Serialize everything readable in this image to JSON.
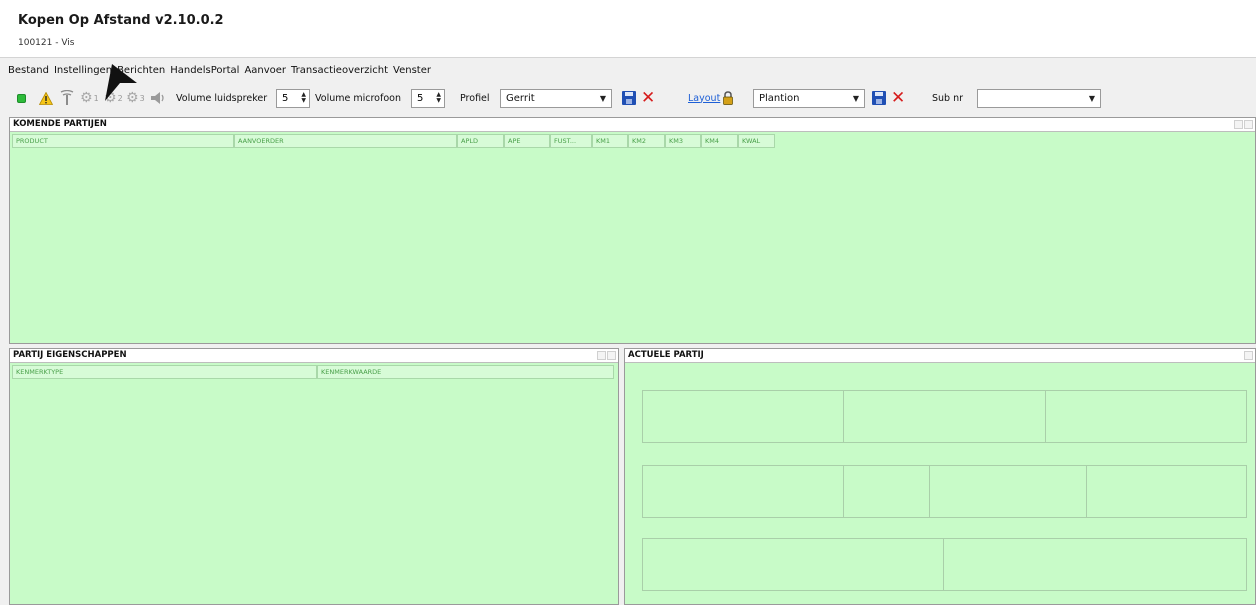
{
  "app": {
    "title": "Kopen Op Afstand v2.10.0.2",
    "subtitle": "100121 - Vis"
  },
  "menu": {
    "items": [
      "Bestand",
      "Instellingen",
      "Berichten",
      "HandelsPortal",
      "Aanvoer",
      "Transactieoverzicht",
      "Venster"
    ]
  },
  "toolbar": {
    "icons": {
      "status": "green-status-icon",
      "warning": "warning-icon",
      "antenna": "antenna-icon",
      "speaker": "speaker-icon"
    },
    "clock_numbers": [
      "1",
      "2",
      "3"
    ],
    "volume_speaker_label": "Volume luidspreker",
    "volume_speaker_value": "5",
    "volume_mic_label": "Volume microfoon",
    "volume_mic_value": "5",
    "profile_label": "Profiel",
    "profile_value": "Gerrit",
    "layout_link": "Layout",
    "layout_value": "Plantion",
    "subnr_label": "Sub nr",
    "subnr_value": ""
  },
  "panels": {
    "komende": {
      "title": "KOMENDE PARTIJEN",
      "columns": [
        "PRODUCT",
        "AANVOERDER",
        "APLD",
        "APE",
        "FUST...",
        "KM1",
        "KM2",
        "KM3",
        "KM4",
        "KWAL"
      ]
    },
    "eigenschappen": {
      "title": "PARTIJ EIGENSCHAPPEN",
      "columns": [
        "KENMERKTYPE",
        "KENMERKWAARDE"
      ]
    },
    "actuele": {
      "title": "ACTUELE PARTIJ"
    }
  },
  "colors": {
    "panel_bg": "#c8fbc8",
    "save_blue": "#1f4fb4",
    "delete_red": "#d61c1c",
    "link_blue": "#1d5fd6"
  }
}
